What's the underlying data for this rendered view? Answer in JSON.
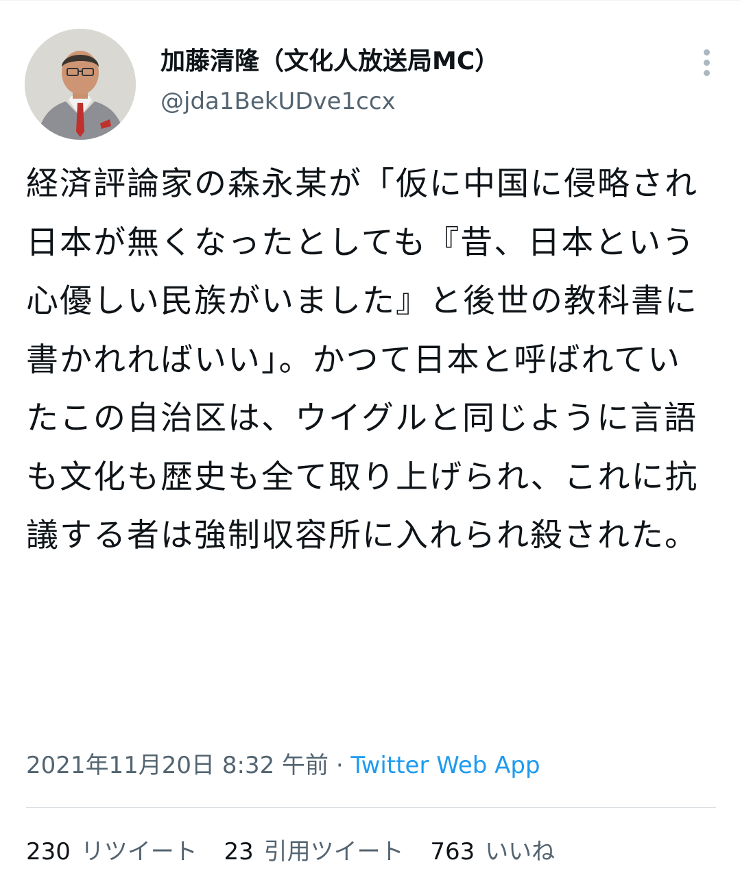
{
  "tweet": {
    "author": {
      "display_name": "加藤清隆（文化人放送局MC）",
      "handle": "@jda1BekUDve1ccx",
      "avatar": "profile-photo"
    },
    "more_icon": "more-vertical-icon",
    "text": "経済評論家の森永某が「仮に中国に侵略され日本が無くなったとしても『昔、日本という心優しい民族がいました』と後世の教科書に書かれればいい」。かつて日本と呼ばれていたこの自治区は、ウイグルと同じように言語も文化も歴史も全て取り上げられ、これに抗議する者は強制収容所に入れられ殺された。",
    "timestamp": "2021年11月20日 8:32 午前",
    "separator": " · ",
    "source": "Twitter Web App"
  },
  "stats": {
    "retweets": {
      "count": "230",
      "label": "リツイート"
    },
    "quotes": {
      "count": "23",
      "label": "引用ツイート"
    },
    "likes": {
      "count": "763",
      "label": "いいね"
    }
  },
  "colors": {
    "text": "#0f1419",
    "secondary": "#536471",
    "link": "#1d9bf0",
    "divider": "#eff3f4"
  }
}
